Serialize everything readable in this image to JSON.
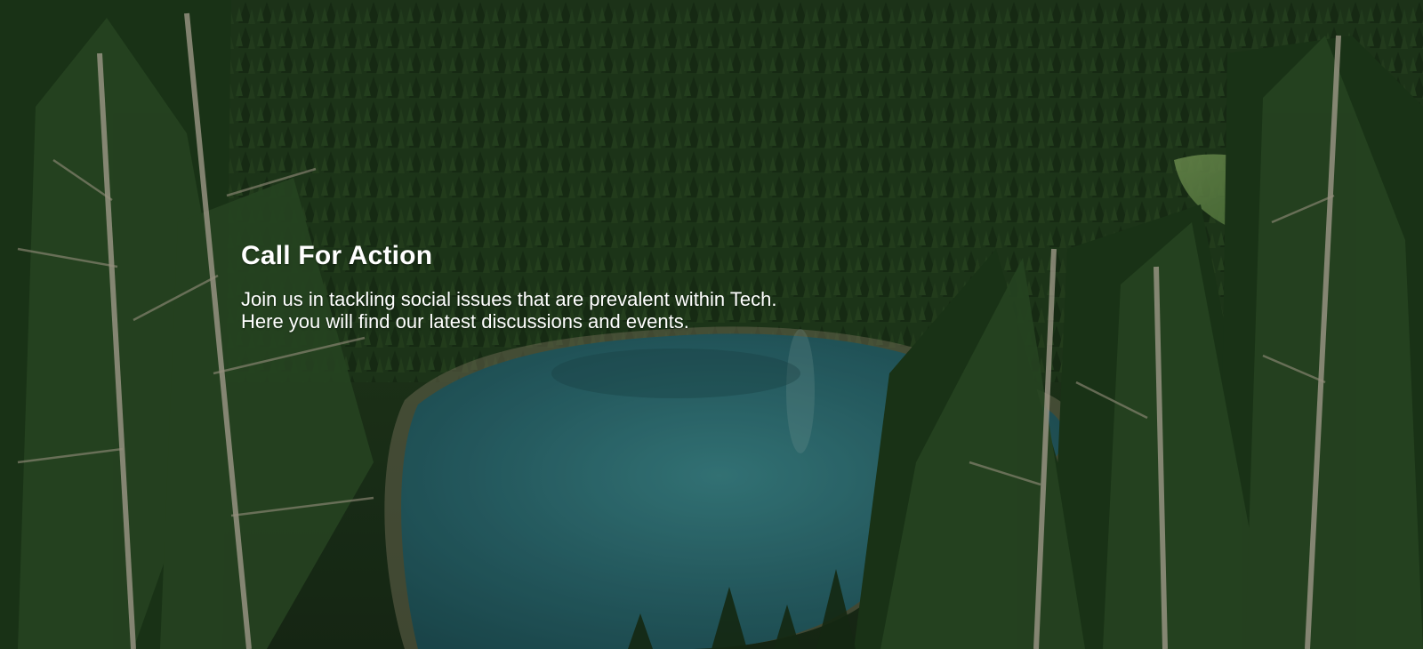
{
  "hero": {
    "title": "Call For Action",
    "description_line1": "Join us in tackling social issues that are prevalent within Tech.",
    "description_line2": "Here you will find our latest discussions and events."
  },
  "colors": {
    "text": "#ffffff",
    "forest_dark": "#1f3a1f",
    "forest_mid": "#2f4d24",
    "lake": "#2f6f73",
    "meadow": "#7aa05a"
  },
  "background": {
    "scene": "forest-lake-photo"
  }
}
